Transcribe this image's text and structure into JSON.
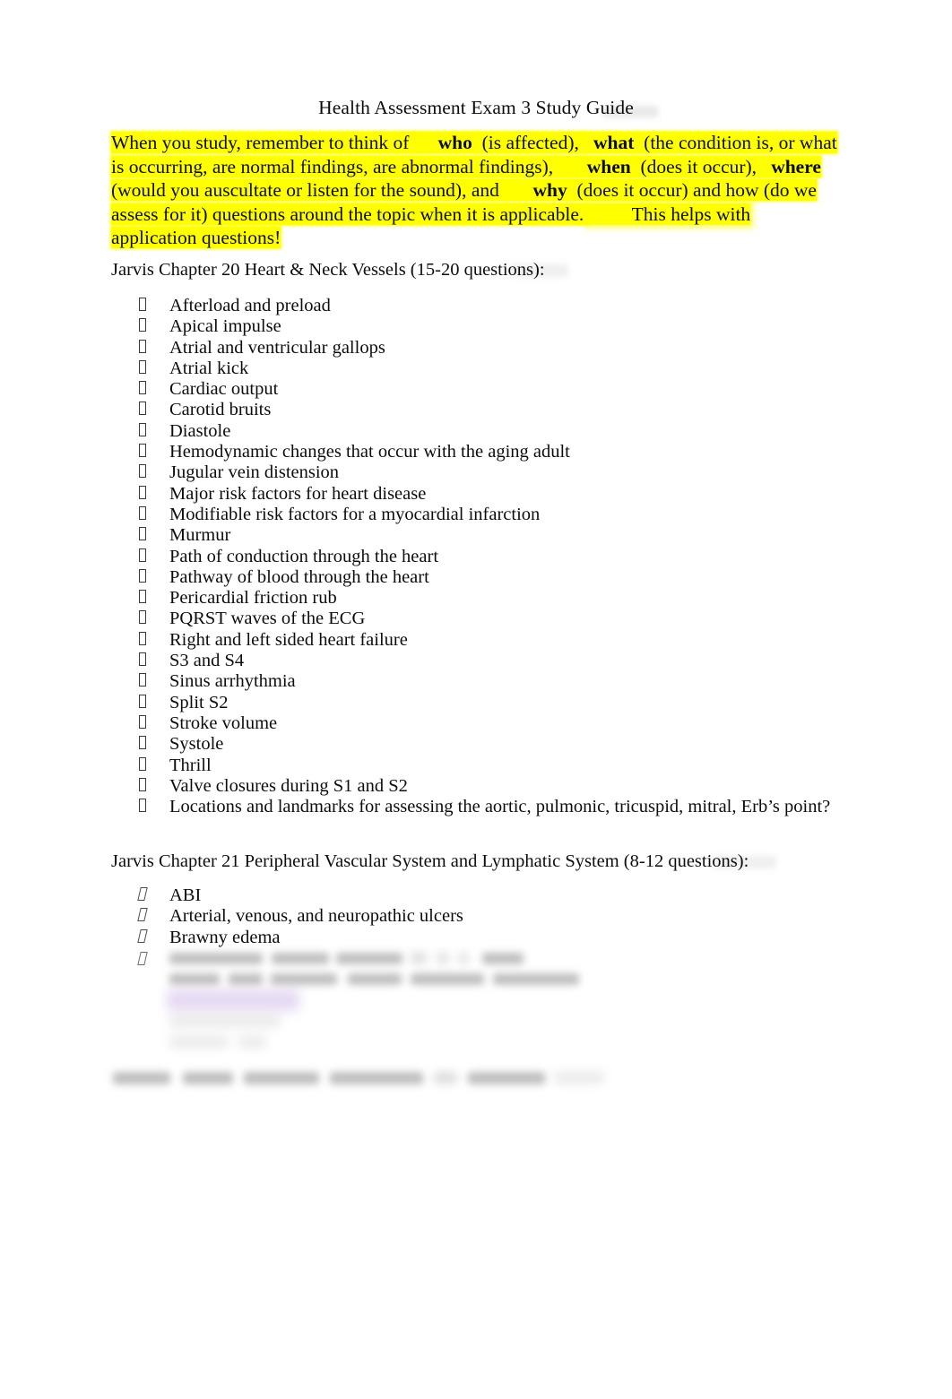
{
  "document": {
    "title": "Health Assessment Exam 3 Study Guide",
    "page_background": "#ffffff",
    "highlight_color": "#ffff00",
    "secondary_highlight_color": "#c4a8e2",
    "text_color": "#0d0d0d"
  },
  "intro": {
    "highlighted": true,
    "lines": [
      {
        "segments": [
          {
            "text": "When you study, remember to think of ",
            "bold": false,
            "highlight": true
          },
          {
            "text": "    who ",
            "bold": true,
            "highlight": true
          },
          {
            "text": " (is affected), ",
            "bold": false,
            "highlight": true
          },
          {
            "text": "  what ",
            "bold": true,
            "highlight": true
          },
          {
            "text": " (the condition is, or what",
            "bold": false,
            "highlight": true
          }
        ]
      },
      {
        "segments": [
          {
            "text": "is occurring, are normal findings, are abnormal findings), ",
            "bold": false,
            "highlight": true
          },
          {
            "text": "      when ",
            "bold": true,
            "highlight": true
          },
          {
            "text": " (does it occur), ",
            "bold": false,
            "highlight": true
          },
          {
            "text": "  where",
            "bold": true,
            "highlight": true
          }
        ]
      },
      {
        "segments": [
          {
            "text": "(would you auscultate or listen for the sound), and ",
            "bold": false,
            "highlight": true
          },
          {
            "text": "      why ",
            "bold": true,
            "highlight": true
          },
          {
            "text": " (does it occur) and how (do we",
            "bold": false,
            "highlight": true
          }
        ]
      },
      {
        "segments": [
          {
            "text": "assess for it) questions around the topic when it is applicable. ",
            "bold": false,
            "highlight": true
          },
          {
            "text": "         This helps with",
            "bold": false,
            "highlight": true
          }
        ]
      },
      {
        "segments": [
          {
            "text": "application questions!",
            "bold": false,
            "highlight": true
          }
        ]
      }
    ]
  },
  "sections": [
    {
      "id": "heart",
      "heading": "Jarvis Chapter 20 Heart & Neck Vessels (15-20 questions):",
      "bullet_style": "upright-box",
      "items": [
        "Afterload and preload",
        "Apical impulse",
        "Atrial and ventricular gallops",
        "Atrial kick",
        "Cardiac output",
        "Carotid bruits",
        "Diastole",
        "Hemodynamic changes that occur with the aging adult",
        "Jugular vein distension",
        "Major risk factors for heart disease",
        "Modifiable risk factors for a myocardial infarction",
        "Murmur",
        "Path of conduction through the heart",
        "Pathway of blood through the heart",
        "Pericardial friction rub",
        "PQRST waves of the ECG",
        "Right and left sided heart failure",
        "S3 and S4",
        "Sinus arrhythmia",
        "Split S2",
        "Stroke volume",
        "Systole",
        "Thrill",
        "Valve closures during S1 and S2",
        "Locations and landmarks for assessing the aortic, pulmonic, tricuspid, mitral, Erb’s point?"
      ]
    },
    {
      "id": "vascular",
      "heading": "Jarvis Chapter 21 Peripheral Vascular System and Lymphatic System (8-12 questions):",
      "bullet_style": "slanted-box",
      "items": [
        "ABI",
        "Arterial, venous, and neuropathic ulcers",
        "Brawny edema"
      ]
    }
  ],
  "obscured": {
    "note": "Remaining lines at the bottom of the page are blurred and illegible in the screenshot."
  }
}
